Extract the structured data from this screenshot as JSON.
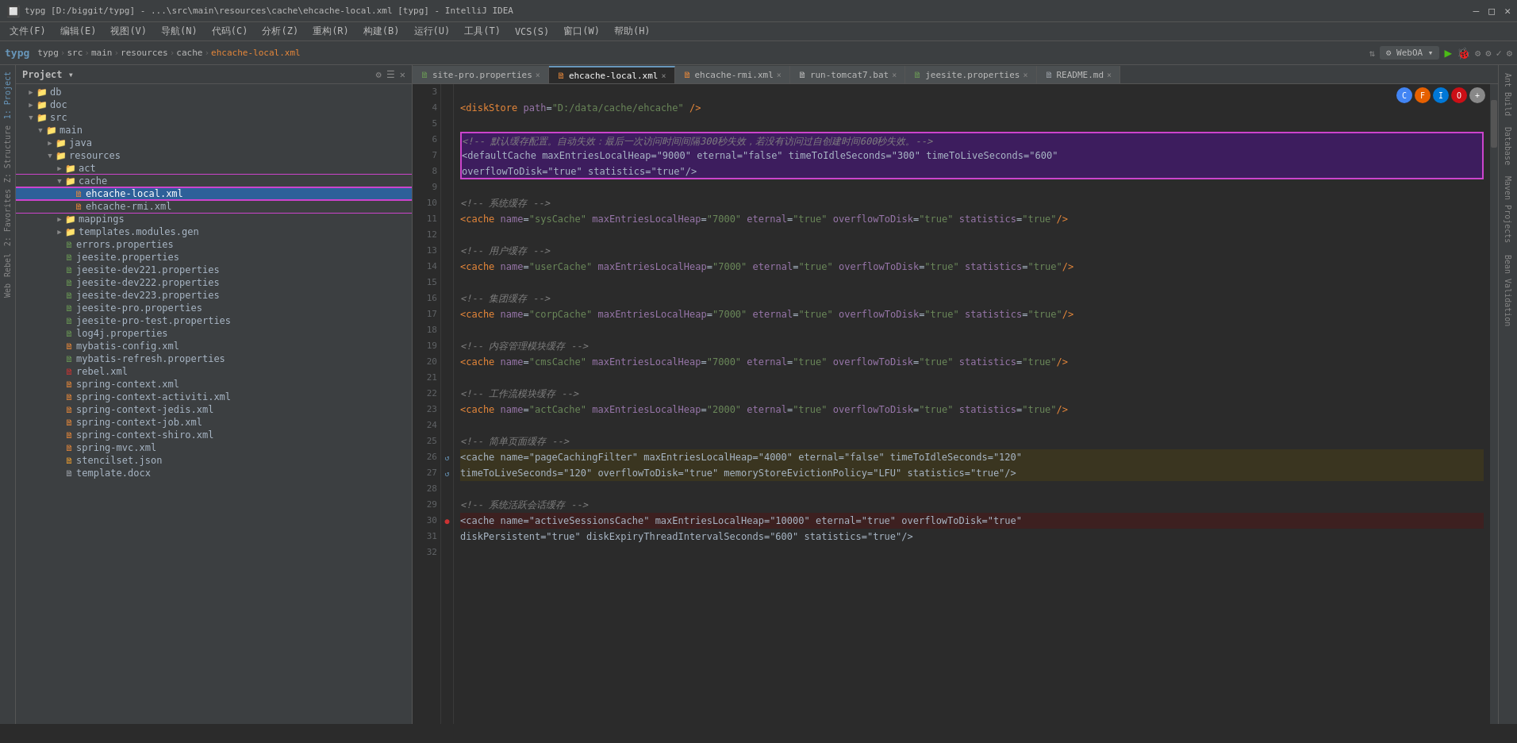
{
  "titleBar": {
    "title": "typg [D:/biggit/typg] - ...\\src\\main\\resources\\cache\\ehcache-local.xml [typg] - IntelliJ IDEA",
    "minimize": "—",
    "maximize": "□",
    "close": "✕"
  },
  "menuBar": {
    "items": [
      "文件(F)",
      "编辑(E)",
      "视图(V)",
      "导航(N)",
      "代码(C)",
      "分析(Z)",
      "重构(R)",
      "构建(B)",
      "运行(U)",
      "工具(T)",
      "VCS(S)",
      "窗口(W)",
      "帮助(H)"
    ]
  },
  "breadcrumb": {
    "items": [
      "typg",
      "src",
      "main",
      "resources",
      "cache",
      "ehcache-local.xml"
    ]
  },
  "tabs": [
    {
      "label": "site-pro.properties",
      "icon": "prop",
      "active": false,
      "modified": false
    },
    {
      "label": "ehcache-local.xml",
      "icon": "xml",
      "active": true,
      "modified": false
    },
    {
      "label": "ehcache-rmi.xml",
      "icon": "xml",
      "active": false,
      "modified": false
    },
    {
      "label": "run-tomcat7.bat",
      "icon": "bat",
      "active": false,
      "modified": false
    },
    {
      "label": "jeesite.properties",
      "icon": "prop",
      "active": false,
      "modified": false
    },
    {
      "label": "README.md",
      "icon": "md",
      "active": false,
      "modified": false
    }
  ],
  "projectPanel": {
    "title": "Project",
    "tree": [
      {
        "indent": 2,
        "arrow": "▶",
        "type": "folder",
        "name": "db",
        "level": 1
      },
      {
        "indent": 2,
        "arrow": "▶",
        "type": "folder",
        "name": "doc",
        "level": 1
      },
      {
        "indent": 2,
        "arrow": "▼",
        "type": "folder",
        "name": "src",
        "level": 1
      },
      {
        "indent": 4,
        "arrow": "▼",
        "type": "folder",
        "name": "main",
        "level": 2
      },
      {
        "indent": 6,
        "arrow": "▶",
        "type": "folder",
        "name": "java",
        "level": 3
      },
      {
        "indent": 6,
        "arrow": "▼",
        "type": "folder",
        "name": "resources",
        "level": 3
      },
      {
        "indent": 8,
        "arrow": "▶",
        "type": "folder",
        "name": "act",
        "level": 4
      },
      {
        "indent": 8,
        "arrow": "▼",
        "type": "folder-highlight",
        "name": "cache",
        "level": 4
      },
      {
        "indent": 10,
        "arrow": "",
        "type": "xml-file",
        "name": "ehcache-local.xml",
        "level": 5,
        "selected": true
      },
      {
        "indent": 10,
        "arrow": "",
        "type": "xml-file",
        "name": "ehcache-rmi.xml",
        "level": 5
      },
      {
        "indent": 8,
        "arrow": "▶",
        "type": "folder",
        "name": "mappings",
        "level": 4
      },
      {
        "indent": 8,
        "arrow": "▶",
        "type": "folder",
        "name": "templates.modules.gen",
        "level": 4
      },
      {
        "indent": 8,
        "arrow": "",
        "type": "prop-file",
        "name": "errors.properties",
        "level": 4
      },
      {
        "indent": 8,
        "arrow": "",
        "type": "prop-file",
        "name": "jeesite.properties",
        "level": 4
      },
      {
        "indent": 8,
        "arrow": "",
        "type": "prop-file",
        "name": "jeesite-dev221.properties",
        "level": 4
      },
      {
        "indent": 8,
        "arrow": "",
        "type": "prop-file",
        "name": "jeesite-dev222.properties",
        "level": 4
      },
      {
        "indent": 8,
        "arrow": "",
        "type": "prop-file",
        "name": "jeesite-dev223.properties",
        "level": 4
      },
      {
        "indent": 8,
        "arrow": "",
        "type": "prop-file",
        "name": "jeesite-pro.properties",
        "level": 4
      },
      {
        "indent": 8,
        "arrow": "",
        "type": "prop-file",
        "name": "jeesite-pro-test.properties",
        "level": 4
      },
      {
        "indent": 8,
        "arrow": "",
        "type": "prop-file",
        "name": "log4j.properties",
        "level": 4
      },
      {
        "indent": 8,
        "arrow": "",
        "type": "xml-file",
        "name": "mybatis-config.xml",
        "level": 4
      },
      {
        "indent": 8,
        "arrow": "",
        "type": "prop-file",
        "name": "mybatis-refresh.properties",
        "level": 4
      },
      {
        "indent": 8,
        "arrow": "",
        "type": "xml-file-red",
        "name": "rebel.xml",
        "level": 4
      },
      {
        "indent": 8,
        "arrow": "",
        "type": "xml-file",
        "name": "spring-context.xml",
        "level": 4
      },
      {
        "indent": 8,
        "arrow": "",
        "type": "xml-file",
        "name": "spring-context-activiti.xml",
        "level": 4
      },
      {
        "indent": 8,
        "arrow": "",
        "type": "xml-file",
        "name": "spring-context-jedis.xml",
        "level": 4
      },
      {
        "indent": 8,
        "arrow": "",
        "type": "xml-file",
        "name": "spring-context-job.xml",
        "level": 4
      },
      {
        "indent": 8,
        "arrow": "",
        "type": "xml-file",
        "name": "spring-context-shiro.xml",
        "level": 4
      },
      {
        "indent": 8,
        "arrow": "",
        "type": "xml-file",
        "name": "spring-mvc.xml",
        "level": 4
      },
      {
        "indent": 8,
        "arrow": "",
        "type": "json-file",
        "name": "stencilset.json",
        "level": 4
      },
      {
        "indent": 8,
        "arrow": "",
        "type": "other-file",
        "name": "template.docx",
        "level": 4
      }
    ]
  },
  "codeLines": [
    {
      "num": 3,
      "content": "",
      "type": "normal",
      "gutter": ""
    },
    {
      "num": 4,
      "content": "        <diskStore path=\"D:/data/cache/ehcache\" />",
      "type": "normal",
      "gutter": ""
    },
    {
      "num": 5,
      "content": "",
      "type": "normal",
      "gutter": ""
    },
    {
      "num": 6,
      "content": "    <!-- 默认缓存配置。自动失效：最后一次访问时间间隔300秒失效，若没有访问过自创建时间600秒失效。-->",
      "type": "highlight-comment",
      "gutter": ""
    },
    {
      "num": 7,
      "content": "    <defaultCache maxEntriesLocalHeap=\"9000\" eternal=\"false\" timeToIdleSeconds=\"300\" timeToLiveSeconds=\"600\"",
      "type": "highlight",
      "gutter": ""
    },
    {
      "num": 8,
      "content": "            overflowToDisk=\"true\" statistics=\"true\"/>",
      "type": "highlight",
      "gutter": ""
    },
    {
      "num": 9,
      "content": "",
      "type": "normal",
      "gutter": ""
    },
    {
      "num": 10,
      "content": "    <!-- 系统缓存 -->",
      "type": "normal",
      "gutter": ""
    },
    {
      "num": 11,
      "content": "    <cache name=\"sysCache\" maxEntriesLocalHeap=\"7000\" eternal=\"true\" overflowToDisk=\"true\" statistics=\"true\"/>",
      "type": "normal",
      "gutter": ""
    },
    {
      "num": 12,
      "content": "",
      "type": "normal",
      "gutter": ""
    },
    {
      "num": 13,
      "content": "    <!-- 用户缓存 -->",
      "type": "normal",
      "gutter": ""
    },
    {
      "num": 14,
      "content": "    <cache name=\"userCache\" maxEntriesLocalHeap=\"7000\" eternal=\"true\" overflowToDisk=\"true\" statistics=\"true\"/>",
      "type": "normal",
      "gutter": ""
    },
    {
      "num": 15,
      "content": "",
      "type": "normal",
      "gutter": ""
    },
    {
      "num": 16,
      "content": "    <!-- 集团缓存 -->",
      "type": "normal",
      "gutter": ""
    },
    {
      "num": 17,
      "content": "    <cache name=\"corpCache\" maxEntriesLocalHeap=\"7000\" eternal=\"true\" overflowToDisk=\"true\" statistics=\"true\"/>",
      "type": "normal",
      "gutter": ""
    },
    {
      "num": 18,
      "content": "",
      "type": "normal",
      "gutter": ""
    },
    {
      "num": 19,
      "content": "    <!-- 内容管理模块缓存 -->",
      "type": "normal",
      "gutter": ""
    },
    {
      "num": 20,
      "content": "    <cache name=\"cmsCache\" maxEntriesLocalHeap=\"7000\" eternal=\"true\" overflowToDisk=\"true\" statistics=\"true\"/>",
      "type": "normal",
      "gutter": ""
    },
    {
      "num": 21,
      "content": "",
      "type": "normal",
      "gutter": ""
    },
    {
      "num": 22,
      "content": "    <!-- 工作流模块缓存 -->",
      "type": "normal",
      "gutter": ""
    },
    {
      "num": 23,
      "content": "    <cache name=\"actCache\" maxEntriesLocalHeap=\"2000\" eternal=\"true\" overflowToDisk=\"true\" statistics=\"true\"/>",
      "type": "normal",
      "gutter": ""
    },
    {
      "num": 24,
      "content": "",
      "type": "normal",
      "gutter": ""
    },
    {
      "num": 25,
      "content": "    <!-- 简单页面缓存 -->",
      "type": "normal",
      "gutter": ""
    },
    {
      "num": 26,
      "content": "    <cache name=\"pageCachingFilter\" maxEntriesLocalHeap=\"4000\" eternal=\"false\" timeToIdleSeconds=\"120\"",
      "type": "light-yellow",
      "gutter": "bookmark"
    },
    {
      "num": 27,
      "content": "            timeToLiveSeconds=\"120\" overflowToDisk=\"true\" memoryStoreEvictionPolicy=\"LFU\" statistics=\"true\"/>",
      "type": "light-yellow",
      "gutter": "bookmark"
    },
    {
      "num": 28,
      "content": "",
      "type": "normal",
      "gutter": ""
    },
    {
      "num": 29,
      "content": "    <!-- 系统活跃会话缓存 -->",
      "type": "normal",
      "gutter": ""
    },
    {
      "num": 30,
      "content": "    <cache name=\"activeSessionsCache\" maxEntriesLocalHeap=\"10000\" eternal=\"true\" overflowToDisk=\"true\"",
      "type": "error-line",
      "gutter": "error"
    },
    {
      "num": 31,
      "content": "            diskPersistent=\"true\" diskExpiryThreadIntervalSeconds=\"600\" statistics=\"true\"/>",
      "type": "normal",
      "gutter": ""
    },
    {
      "num": 32,
      "content": "",
      "type": "normal",
      "gutter": ""
    }
  ],
  "rightSidebar": {
    "items": [
      "Ant Build",
      "Database",
      "Maven Projects",
      "Bean Validation"
    ]
  },
  "leftSidebar": {
    "items": [
      "1: Project",
      "Z: Structure",
      "2: Favorites",
      "Rebel"
    ]
  }
}
